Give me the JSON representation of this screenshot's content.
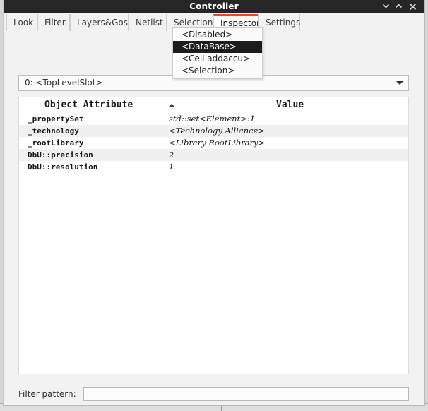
{
  "window": {
    "title": "Controller",
    "buttons": [
      {
        "name": "shade-button",
        "glyph": "chevron-down-icon"
      },
      {
        "name": "unshade-button",
        "glyph": "chevron-up-icon"
      },
      {
        "name": "close-button",
        "glyph": "close-icon"
      }
    ]
  },
  "tabs": [
    {
      "label": "Look",
      "active": false
    },
    {
      "label": "Filter",
      "active": false
    },
    {
      "label": "Layers&Gos",
      "active": false
    },
    {
      "label": "Netlist",
      "active": false
    },
    {
      "label": "Selection",
      "active": false
    },
    {
      "label": "Inspector",
      "active": true
    },
    {
      "label": "Settings",
      "active": false
    }
  ],
  "popup_menu": {
    "items": [
      {
        "label": "<Disabled>",
        "selected": false
      },
      {
        "label": "<DataBase>",
        "selected": true
      },
      {
        "label": "<Cell addaccu>",
        "selected": false
      },
      {
        "label": "<Selection>",
        "selected": false
      }
    ]
  },
  "slot_combo": {
    "value": "0: <TopLevelSlot>"
  },
  "table": {
    "columns": [
      {
        "label": "Object Attribute",
        "sort": "ascending"
      },
      {
        "label": "Value",
        "sort": "none"
      }
    ],
    "rows": [
      {
        "attribute": "_propertySet",
        "value": "std::set<Element>:1"
      },
      {
        "attribute": "_technology",
        "value": "<Technology Alliance>"
      },
      {
        "attribute": "_rootLibrary",
        "value": "<Library RootLibrary>"
      },
      {
        "attribute": "DbU::precision",
        "value": "2"
      },
      {
        "attribute": "DbU::resolution",
        "value": "1"
      }
    ]
  },
  "filter": {
    "label_prefix": "F",
    "label_rest": "ilter pattern:",
    "value": "",
    "placeholder": ""
  },
  "colors": {
    "titlebar": "#262626",
    "accent": "#e0501e",
    "menu_highlight": "#1c1c1c",
    "panel": "#f2f2f2",
    "row_alt": "#f0f0f0"
  }
}
